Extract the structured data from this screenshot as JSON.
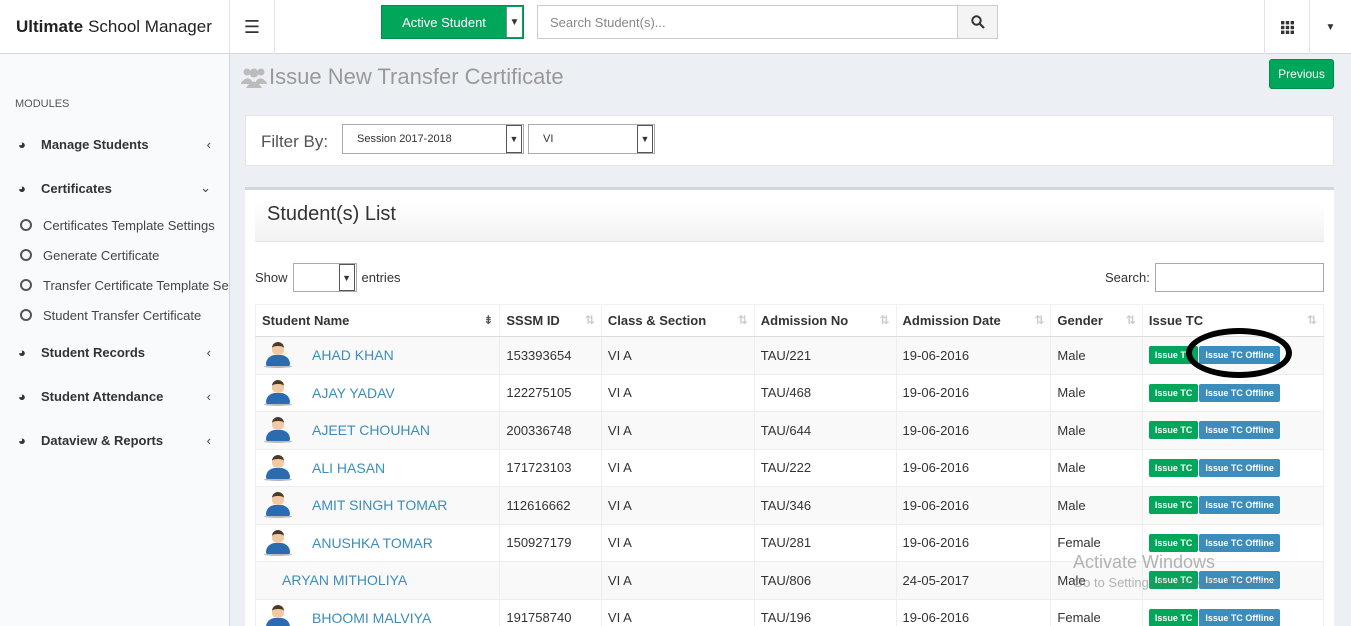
{
  "app": {
    "brand_bold": "Ultimate",
    "brand_rest": "School Manager"
  },
  "header": {
    "status_select": "Active Student",
    "search_placeholder": "Search Student(s)..."
  },
  "sidebar": {
    "header": "MODULES",
    "items": [
      {
        "label": "Manage Students",
        "chevron": "‹"
      },
      {
        "label": "Certificates",
        "chevron": "⌄"
      },
      {
        "label": "Student Records",
        "chevron": "‹"
      },
      {
        "label": "Student Attendance",
        "chevron": "‹"
      },
      {
        "label": "Dataview & Reports",
        "chevron": "‹"
      }
    ],
    "sub_items": [
      "Certificates Template Settings",
      "Generate Certificate",
      "Transfer Certificate Template Settings",
      "Student Transfer Certificate"
    ]
  },
  "page": {
    "title": "Issue New Transfer Certificate",
    "previous_label": "Previous",
    "filter_label": "Filter By:",
    "session_value": "Session 2017-2018",
    "class_value": "VI"
  },
  "list": {
    "title": "Student(s) List",
    "show_label": "Show",
    "entries_label": "entries",
    "search_label": "Search:",
    "columns": [
      "Student Name",
      "SSSM ID",
      "Class & Section",
      "Admission No",
      "Admission Date",
      "Gender",
      "Issue TC"
    ],
    "issue_tc_label": "Issue TC",
    "issue_offline_label": "Issue TC Offline",
    "rows": [
      {
        "name": "AHAD KHAN",
        "sssm": "153393654",
        "cls": "VI A",
        "adm": "TAU/221",
        "date": "19-06-2016",
        "gender": "Male",
        "avatar": true
      },
      {
        "name": "AJAY YADAV",
        "sssm": "122275105",
        "cls": "VI A",
        "adm": "TAU/468",
        "date": "19-06-2016",
        "gender": "Male",
        "avatar": true
      },
      {
        "name": "AJEET CHOUHAN",
        "sssm": "200336748",
        "cls": "VI A",
        "adm": "TAU/644",
        "date": "19-06-2016",
        "gender": "Male",
        "avatar": true
      },
      {
        "name": "ALI HASAN",
        "sssm": "171723103",
        "cls": "VI A",
        "adm": "TAU/222",
        "date": "19-06-2016",
        "gender": "Male",
        "avatar": true
      },
      {
        "name": "AMIT SINGH TOMAR",
        "sssm": "112616662",
        "cls": "VI A",
        "adm": "TAU/346",
        "date": "19-06-2016",
        "gender": "Male",
        "avatar": true
      },
      {
        "name": "ANUSHKA TOMAR",
        "sssm": "150927179",
        "cls": "VI A",
        "adm": "TAU/281",
        "date": "19-06-2016",
        "gender": "Female",
        "avatar": true
      },
      {
        "name": "ARYAN MITHOLIYA",
        "sssm": "",
        "cls": "VI A",
        "adm": "TAU/806",
        "date": "24-05-2017",
        "gender": "Male",
        "avatar": false
      },
      {
        "name": "BHOOMI MALVIYA",
        "sssm": "191758740",
        "cls": "VI A",
        "adm": "TAU/196",
        "date": "19-06-2016",
        "gender": "Female",
        "avatar": true
      }
    ]
  },
  "watermark": {
    "line1": "Activate Windows",
    "line2": "Go to Settings to activate Windows."
  },
  "colors": {
    "green": "#00a65a",
    "blue": "#3c8dbc",
    "sidebar_bg": "#f9fafc",
    "body_bg": "#ecf0f5"
  }
}
